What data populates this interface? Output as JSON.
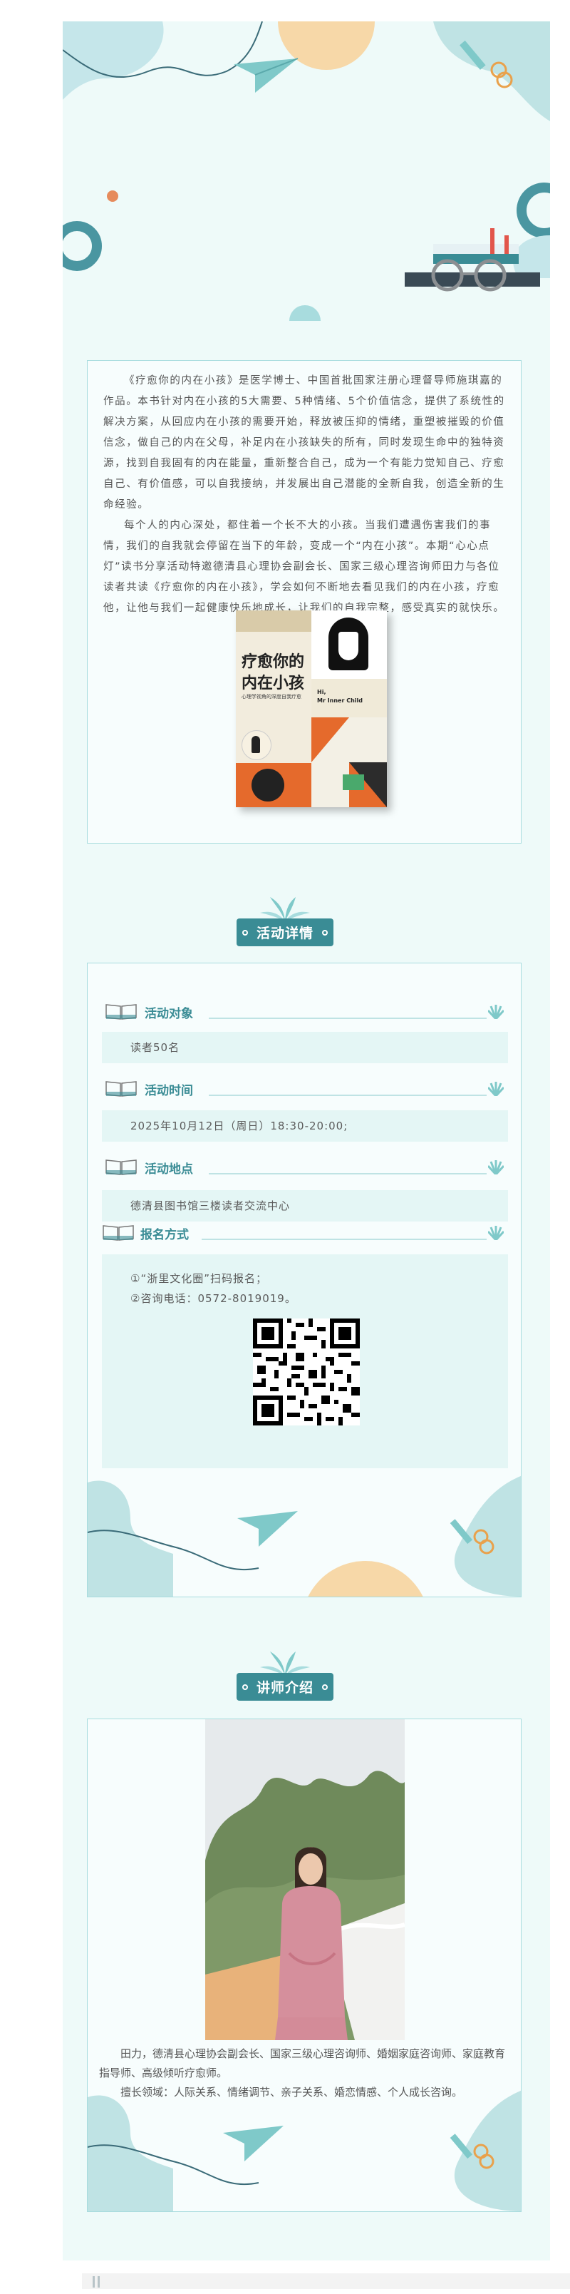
{
  "intro": {
    "paragraph1": "《疗愈你的内在小孩》是医学博士、中国首批国家注册心理督导师施琪嘉的作品。本书针对内在小孩的5大需要、5种情绪、5个价值信念，提供了系统性的解决方案，从回应内在小孩的需要开始，释放被压抑的情绪，重塑被摧毁的价值信念，做自己的内在父母，补足内在小孩缺失的所有，同时发现生命中的独特资源，找到自我固有的内在能量，重新整合自己，成为一个有能力觉知自己、疗愈自己、有价值感，可以自我接纳，并发展出自己潜能的全新自我，创造全新的生命经验。",
    "paragraph2": "每个人的内心深处，都住着一个长不大的小孩。当我们遭遇伤害我们的事情，我们的自我就会停留在当下的年龄，变成一个“内在小孩”。本期“心心点灯”读书分享活动特邀德清县心理协会副会长、国家三级心理咨询师田力与各位读者共读《疗愈你的内在小孩》，学会如何不断地去看见我们的内在小孩，疗愈他，让他与我们一起健康快乐地成长，让我们的自我完整，感受真实的就快乐。"
  },
  "book": {
    "title_line1": "疗愈你的",
    "title_line2": "内在小孩",
    "subtitle": "心理学视角的深度自我疗愈",
    "author_en_line1": "Hi,",
    "author_en_line2": "Mr Inner Child"
  },
  "activity": {
    "heading": "活动详情",
    "target_title": "活动对象",
    "target_value": "读者50名",
    "time_title": "活动时间",
    "time_value": "2025年10月12日（周日）18:30-20:00;",
    "place_title": "活动地点",
    "place_value": "德清县图书馆三楼读者交流中心",
    "signup_title": "报名方式",
    "signup_line1": "①“浙里文化圈”扫码报名；",
    "signup_line2": "②咨询电话：0572-8019019。"
  },
  "lecturer": {
    "heading": "讲师介绍",
    "bio_line1": "田力，德清县心理协会副会长、国家三级心理咨询师、婚姻家庭咨询师、家庭教育指导师、高级倾听疗愈师。",
    "bio_line2": "擅长领域：人际关系、情绪调节、亲子关系、婚恋情感、个人成长咨询。"
  },
  "colors": {
    "teal": "#3a8c95",
    "light_teal": "#bfe3e4",
    "panel_bg": "#f7fdfd",
    "strip_bg": "#eefaf9",
    "accent_orange": "#f7d8a8"
  }
}
